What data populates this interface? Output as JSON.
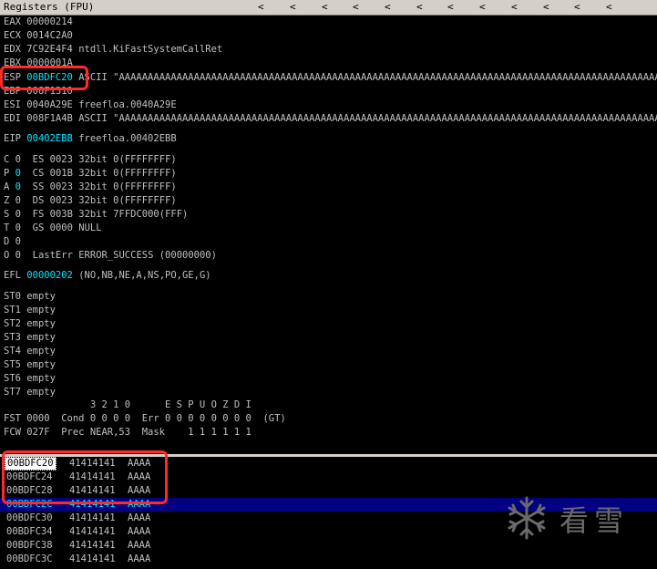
{
  "window": {
    "title": "Registers (FPU)",
    "nav_arrow": "<"
  },
  "registers": {
    "eax": {
      "name": "EAX",
      "value": "00000214"
    },
    "ecx": {
      "name": "ECX",
      "value": "0014C2A0"
    },
    "edx": {
      "name": "EDX",
      "value": "7C92E4F4",
      "comment": "ntdll.KiFastSystemCallRet"
    },
    "ebx": {
      "name": "EBX",
      "value": "0000001A"
    },
    "esp": {
      "name": "ESP",
      "value": "00BDFC20",
      "comment": "ASCII \"AAAAAAAAAAAAAAAAAAAAAAAAAAAAAAAAAAAAAAAAAAAAAAAAAAAAAAAAAAAAAAAAAAAAAAAAAAAAAAAAAAAAAAAAAAAAAAAAAAAAAAAAA"
    },
    "ebp": {
      "name": "EBP",
      "value": "008F1310"
    },
    "esi": {
      "name": "ESI",
      "value": "0040A29E",
      "comment": "freefloa.0040A29E"
    },
    "edi": {
      "name": "EDI",
      "value": "008F1A4B",
      "comment": "ASCII \"AAAAAAAAAAAAAAAAAAAAAAAAAAAAAAAAAAAAAAAAAAAAAAAAAAAAAAAAAAAAAAAAAAAAAAAAAAAAAAAAAAAAAAAAAAAAAAAAAAAAAAAAA"
    },
    "eip": {
      "name": "EIP",
      "value": "00402EBB",
      "comment": "freefloa.00402EBB"
    }
  },
  "flags": [
    {
      "flag": "C",
      "bit": "0",
      "seg": "ES",
      "sel": "0023",
      "desc": "32bit 0(FFFFFFFF)"
    },
    {
      "flag": "P",
      "bit": "0",
      "seg": "CS",
      "sel": "001B",
      "desc": "32bit 0(FFFFFFFF)"
    },
    {
      "flag": "A",
      "bit": "0",
      "seg": "SS",
      "sel": "0023",
      "desc": "32bit 0(FFFFFFFF)"
    },
    {
      "flag": "Z",
      "bit": "0",
      "seg": "DS",
      "sel": "0023",
      "desc": "32bit 0(FFFFFFFF)"
    },
    {
      "flag": "S",
      "bit": "0",
      "seg": "FS",
      "sel": "003B",
      "desc": "32bit 7FFDC000(FFF)"
    },
    {
      "flag": "T",
      "bit": "0",
      "seg": "GS",
      "sel": "0000",
      "desc": "NULL"
    },
    {
      "flag": "D",
      "bit": "0",
      "seg": "",
      "sel": "",
      "desc": ""
    }
  ],
  "lasterr": {
    "o": "O",
    "bit": "0",
    "label": "LastErr",
    "value": "ERROR_SUCCESS (00000000)"
  },
  "efl": {
    "name": "EFL",
    "value": "00000202",
    "comment": "(NO,NB,NE,A,NS,PO,GE,G)"
  },
  "fpu": [
    {
      "name": "ST0",
      "value": "empty"
    },
    {
      "name": "ST1",
      "value": "empty"
    },
    {
      "name": "ST2",
      "value": "empty"
    },
    {
      "name": "ST3",
      "value": "empty"
    },
    {
      "name": "ST4",
      "value": "empty"
    },
    {
      "name": "ST5",
      "value": "empty"
    },
    {
      "name": "ST6",
      "value": "empty"
    },
    {
      "name": "ST7",
      "value": "empty"
    }
  ],
  "fpu_status": {
    "header": "               3 2 1 0      E S P U O Z D I",
    "fst": "FST 0000  Cond 0 0 0 0  Err 0 0 0 0 0 0 0 0  (GT)",
    "fcw": "FCW 027F  Prec NEAR,53  Mask    1 1 1 1 1 1"
  },
  "stack": [
    {
      "address": "00BDFC20",
      "value": "41414141",
      "ascii": "AAAA"
    },
    {
      "address": "00BDFC24",
      "value": "41414141",
      "ascii": "AAAA"
    },
    {
      "address": "00BDFC28",
      "value": "41414141",
      "ascii": "AAAA"
    },
    {
      "address": "00BDFC2C",
      "value": "41414141",
      "ascii": "AAAA"
    },
    {
      "address": "00BDFC30",
      "value": "41414141",
      "ascii": "AAAA"
    },
    {
      "address": "00BDFC34",
      "value": "41414141",
      "ascii": "AAAA"
    },
    {
      "address": "00BDFC38",
      "value": "41414141",
      "ascii": "AAAA"
    },
    {
      "address": "00BDFC3C",
      "value": "41414141",
      "ascii": "AAAA"
    }
  ],
  "watermark": {
    "text": "看雪",
    "icon": "snowflake-icon"
  },
  "colors": {
    "highlight": "#00e5ff",
    "annotation": "#ff2a2a",
    "selection": "#000080"
  }
}
